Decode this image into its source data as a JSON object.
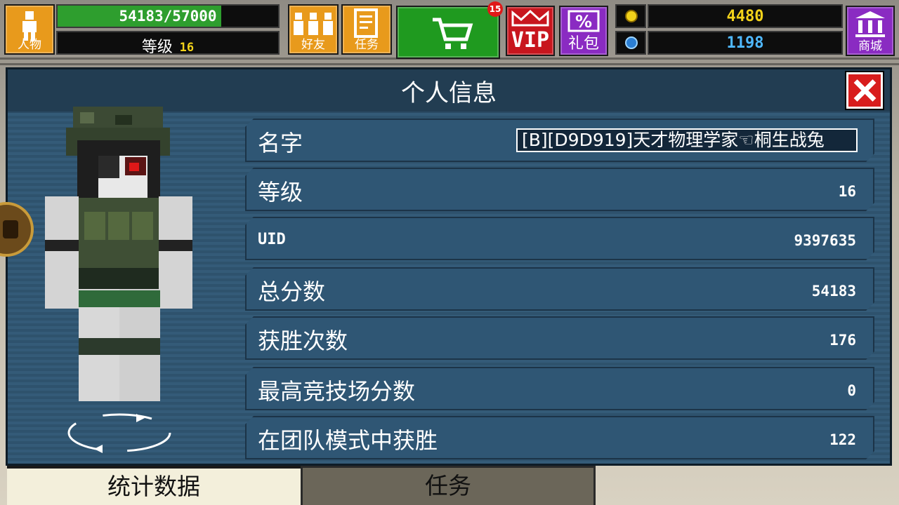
{
  "topbar": {
    "character": {
      "label": "人物",
      "icon": "person-icon"
    },
    "xp": {
      "text": "54183/57000",
      "progress": 0.9506
    },
    "level": {
      "label": "等级",
      "value": "16"
    },
    "friends": {
      "label": "好友",
      "icon": "friends-icon"
    },
    "tasks": {
      "label": "任务",
      "icon": "checklist-icon"
    },
    "cart": {
      "icon": "cart-icon",
      "badge": "15"
    },
    "vip": {
      "label": "VIP",
      "icon": "crown-icon"
    },
    "gift": {
      "label": "礼包",
      "icon": "percent-icon"
    },
    "coins": {
      "value": "4480",
      "icon": "coin-icon"
    },
    "gems": {
      "value": "1198",
      "icon": "gem-icon"
    },
    "shop": {
      "label": "商城",
      "icon": "bank-icon"
    }
  },
  "panel": {
    "title": "个人信息",
    "rows": [
      {
        "label": "名字",
        "value": "[B][D9D919]天才物理学家☜桐生战兔"
      },
      {
        "label": "等级",
        "value": "16"
      },
      {
        "label": "UID",
        "value": "9397635"
      },
      {
        "label": "总分数",
        "value": "54183"
      },
      {
        "label": "获胜次数",
        "value": "176"
      },
      {
        "label": "最高竞技场分数",
        "value": "0"
      },
      {
        "label": "在团队模式中获胜",
        "value": "122"
      }
    ]
  },
  "tabs": [
    {
      "label": "统计数据",
      "active": true
    },
    {
      "label": "任务",
      "active": false
    }
  ],
  "colors": {
    "xp_green": "#2e9e2e",
    "coin_yellow": "#f2d21a",
    "gem_blue": "#4fb8ff",
    "vip_red": "#c8161e",
    "gift_purple": "#8a2bc2",
    "cart_green": "#1f9a1f",
    "orange_btn": "#e89a1c"
  }
}
